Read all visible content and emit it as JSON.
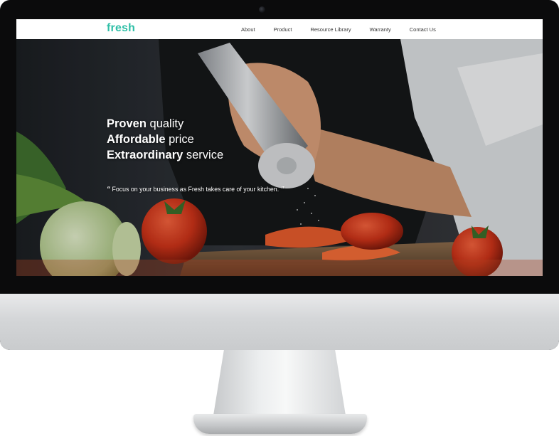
{
  "site": {
    "logo": "fresh",
    "nav": [
      {
        "label": "About"
      },
      {
        "label": "Product"
      },
      {
        "label": "Resource Library"
      },
      {
        "label": "Warranty"
      },
      {
        "label": "Contact Us"
      }
    ]
  },
  "hero": {
    "lines": [
      {
        "strong": "Proven",
        "rest": " quality"
      },
      {
        "strong": "Affordable",
        "rest": " price"
      },
      {
        "strong": "Extraordinary",
        "rest": " service"
      }
    ],
    "quote_open": "“",
    "tagline": "Focus on your business as Fresh takes care of your kitchen.",
    "quote_close": "”"
  },
  "colors": {
    "brand": "#2fbfa7",
    "bezel": "#0b0b0c",
    "chin": "#d4d6d8"
  }
}
